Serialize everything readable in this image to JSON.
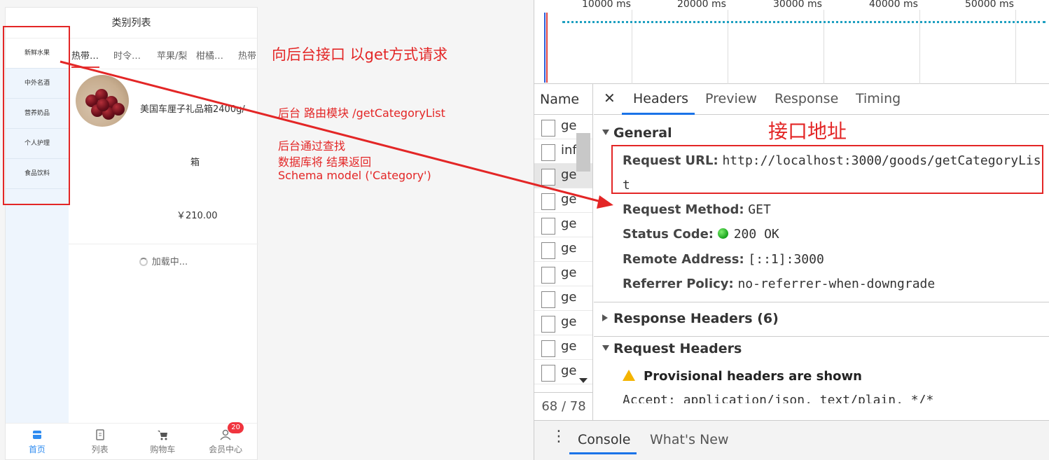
{
  "app": {
    "title": "类别列表",
    "categories": [
      "新鲜水果",
      "中外名酒",
      "营养奶品",
      "个人护理",
      "食品饮料"
    ],
    "tabs": [
      "热带…",
      "时令…",
      "苹果/梨",
      "柑橘…",
      "热带"
    ],
    "goods": {
      "name": "美国车厘子礼品箱2400g/",
      "name_cont": "箱",
      "price": "￥210.00"
    },
    "loading": "加载中...",
    "tabbar": [
      {
        "label": "首页",
        "icon": "home-icon"
      },
      {
        "label": "列表",
        "icon": "list-icon"
      },
      {
        "label": "购物车",
        "icon": "cart-icon"
      },
      {
        "label": "会员中心",
        "icon": "user-icon"
      }
    ],
    "badge": "20"
  },
  "annotations": {
    "get_request": "向后台接口 以get方式请求",
    "route_module": "后台 路由模块 /getCategoryList",
    "lookup_1": "后台通过查找",
    "lookup_2": "数据库将 结果返回",
    "lookup_3": "Schema model ('Category')",
    "api_address": "接口地址"
  },
  "devtools": {
    "timeline_ticks": [
      "10000 ms",
      "20000 ms",
      "30000 ms",
      "40000 ms",
      "50000 ms"
    ],
    "name_header": "Name",
    "requests": [
      "ge",
      "inf",
      "ge",
      "ge",
      "ge",
      "ge",
      "ge",
      "ge",
      "ge",
      "ge",
      "ge"
    ],
    "selected_request": 2,
    "count": "68 / 78",
    "tabs": [
      "Headers",
      "Preview",
      "Response",
      "Timing"
    ],
    "general": {
      "title": "General",
      "url_key": "Request URL:",
      "url_val_1": "http://localhost:3000/goods/getCategoryLis",
      "url_val_2": "t",
      "method_key": "Request Method:",
      "method_val": "GET",
      "status_key": "Status Code:",
      "status_val": "200 OK",
      "remote_key": "Remote Address:",
      "remote_val": "[::1]:3000",
      "referrer_key": "Referrer Policy:",
      "referrer_val": "no-referrer-when-downgrade"
    },
    "response_headers": "Response Headers (6)",
    "request_headers": "Request Headers",
    "provisional": "Provisional headers are shown",
    "accept": "Accept: application/json, text/plain, */*",
    "drawer_tabs": [
      "Console",
      "What's New"
    ]
  },
  "colors": {
    "accent_red": "#e32626",
    "devtools_blue": "#1a73e8",
    "app_blue": "#2f8cf0"
  }
}
